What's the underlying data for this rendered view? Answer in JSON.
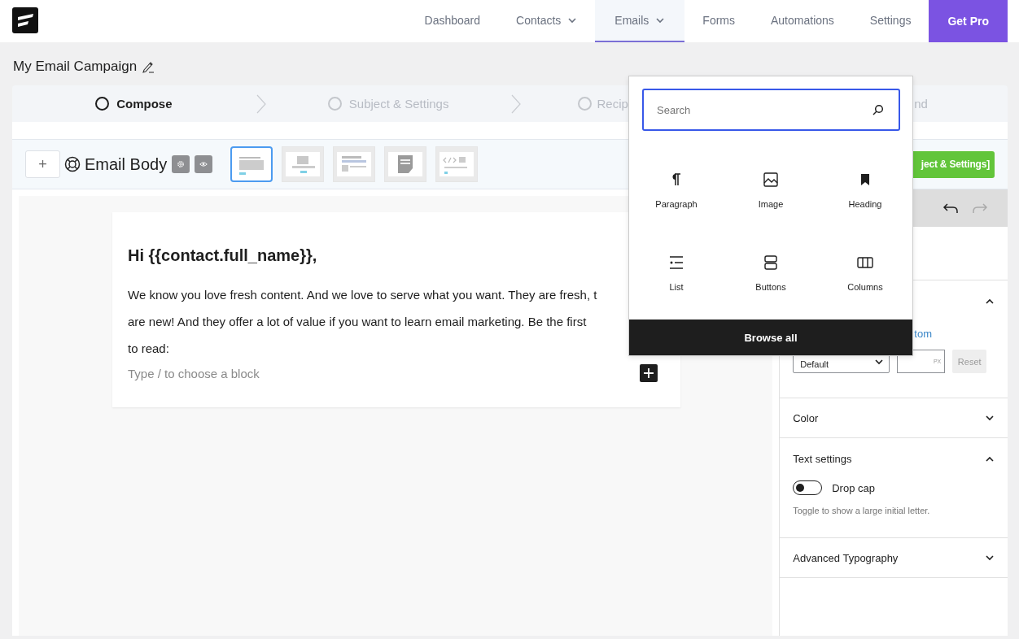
{
  "nav": {
    "items": [
      {
        "label": "Dashboard",
        "dropdown": false,
        "selected": false
      },
      {
        "label": "Contacts",
        "dropdown": true,
        "selected": false
      },
      {
        "label": "Emails",
        "dropdown": true,
        "selected": true
      },
      {
        "label": "Forms",
        "dropdown": false,
        "selected": false
      },
      {
        "label": "Automations",
        "dropdown": false,
        "selected": false
      },
      {
        "label": "Settings",
        "dropdown": false,
        "selected": false
      }
    ],
    "cta": "Get Pro"
  },
  "campaign": {
    "title": "My Email Campaign"
  },
  "steps": [
    {
      "label": "Compose",
      "selected": true
    },
    {
      "label": "Subject & Settings",
      "selected": false
    },
    {
      "label": "Recip",
      "selected": false
    },
    {
      "label": "nd",
      "selected": false
    }
  ],
  "toolbar": {
    "add_button": "+",
    "title": "Email Body",
    "templates": [
      {
        "kind": "text",
        "selected": true
      },
      {
        "kind": "image",
        "selected": false
      },
      {
        "kind": "article",
        "selected": false
      },
      {
        "kind": "note",
        "selected": false
      },
      {
        "kind": "code",
        "selected": false
      }
    ],
    "next_button": "ject & Settings]"
  },
  "email": {
    "heading": "Hi {{contact.full_name}},",
    "paragraph_lines": [
      "We know you love fresh content. And we love to serve what you want. They are fresh,  t",
      "are new! And they offer a lot of value if you want to learn email marketing. Be the first",
      "to read:"
    ],
    "placeholder": "Type / to choose a block"
  },
  "sidebar": {
    "sections": [
      {
        "kind": "typography",
        "expanded": true,
        "link": "tom",
        "select": "Default",
        "unit": "PX",
        "reset": "Reset"
      },
      {
        "title": "Color",
        "expanded": false
      },
      {
        "kind": "text",
        "title": "Text settings",
        "expanded": true,
        "toggle": {
          "label": "Drop cap",
          "on": false
        },
        "help": "Toggle to show a large initial letter."
      },
      {
        "title": "Advanced Typography",
        "expanded": false
      }
    ]
  },
  "inserter": {
    "search": {
      "placeholder": "Search"
    },
    "blocks": [
      {
        "kind": "paragraph",
        "label": "Paragraph"
      },
      {
        "kind": "image",
        "label": "Image"
      },
      {
        "kind": "heading",
        "label": "Heading"
      },
      {
        "kind": "list",
        "label": "List"
      },
      {
        "kind": "buttons",
        "label": "Buttons"
      },
      {
        "kind": "columns",
        "label": "Columns"
      }
    ],
    "browse": "Browse all"
  }
}
